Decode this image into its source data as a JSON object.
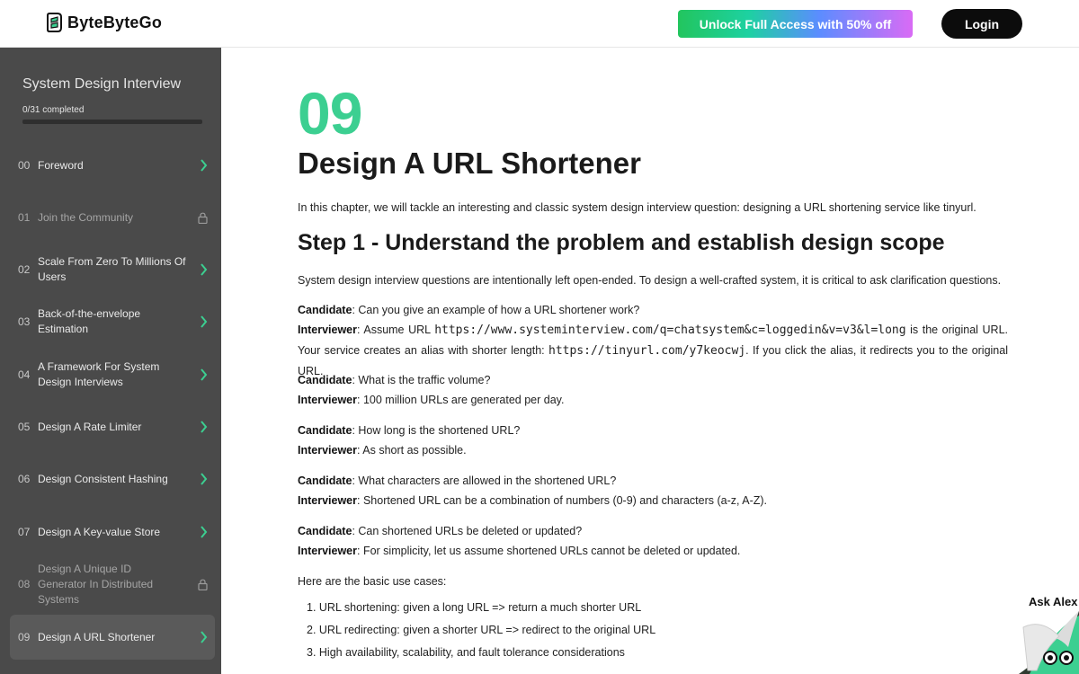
{
  "header": {
    "logo_text": "ByteByteGo",
    "unlock_label": "Unlock Full Access with 50% off",
    "login_label": "Login"
  },
  "sidebar": {
    "course_title": "System Design Interview",
    "completed_text": "0/31 completed",
    "progress_fraction": 0,
    "items": [
      {
        "num": "00",
        "label": "Foreword",
        "locked": false
      },
      {
        "num": "01",
        "label": "Join the Community",
        "locked": true
      },
      {
        "num": "02",
        "label": "Scale From Zero To Millions Of Users",
        "locked": false
      },
      {
        "num": "03",
        "label": "Back-of-the-envelope Estimation",
        "locked": false
      },
      {
        "num": "04",
        "label": "A Framework For System Design Interviews",
        "locked": false
      },
      {
        "num": "05",
        "label": "Design A Rate Limiter",
        "locked": false
      },
      {
        "num": "06",
        "label": "Design Consistent Hashing",
        "locked": false
      },
      {
        "num": "07",
        "label": "Design A Key-value Store",
        "locked": false
      },
      {
        "num": "08",
        "label": "Design A Unique ID Generator In Distributed Systems",
        "locked": true
      },
      {
        "num": "09",
        "label": "Design A URL Shortener",
        "locked": false,
        "active": true
      }
    ]
  },
  "content": {
    "chapter_number": "09",
    "chapter_title": "Design A URL Shortener",
    "intro": "In this chapter, we will tackle an interesting and classic system design interview question: designing a URL shortening service like tinyurl.",
    "step1_heading": "Step 1 - Understand the problem and establish design scope",
    "step1_intro": "System design interview questions are intentionally left open-ended. To design a well-crafted system, it is critical to ask clarification questions.",
    "candidate_label": "Candidate",
    "interviewer_label": "Interviewer",
    "qa": [
      {
        "q": ": Can you give an example of how a URL shortener work?",
        "a_pre": ": Assume URL ",
        "a_code1": "https://www.systeminterview.com/q=chatsystem&c=loggedin&v=v3&l=long",
        "a_mid": " is the original URL. Your service creates an alias with shorter length: ",
        "a_code2": "https://tinyurl.com/y7keocwj",
        "a_post": ". If you click the alias, it redirects you to the original URL."
      },
      {
        "q": ": What is the traffic volume?",
        "a": ": 100 million URLs are generated per day."
      },
      {
        "q": ": How long is the shortened URL?",
        "a": ": As short as possible."
      },
      {
        "q": ": What characters are allowed in the shortened URL?",
        "a": ": Shortened URL can be a combination of numbers (0-9) and characters (a-z, A-Z)."
      },
      {
        "q": ": Can shortened URLs be deleted or updated?",
        "a": ": For simplicity, let us assume shortened URLs cannot be deleted or updated."
      }
    ],
    "use_cases_intro": "Here are the basic use cases:",
    "use_cases": [
      "1. URL shortening: given a long URL => return a much shorter URL",
      "2. URL redirecting: given a shorter URL => redirect to the original URL",
      "3. High availability, scalability, and fault tolerance considerations"
    ]
  },
  "assistant": {
    "label": "Ask Alex"
  },
  "colors": {
    "accent_green": "#3ccf91",
    "sidebar_bg": "#4a4a4a",
    "login_bg": "#0c0c0c"
  }
}
